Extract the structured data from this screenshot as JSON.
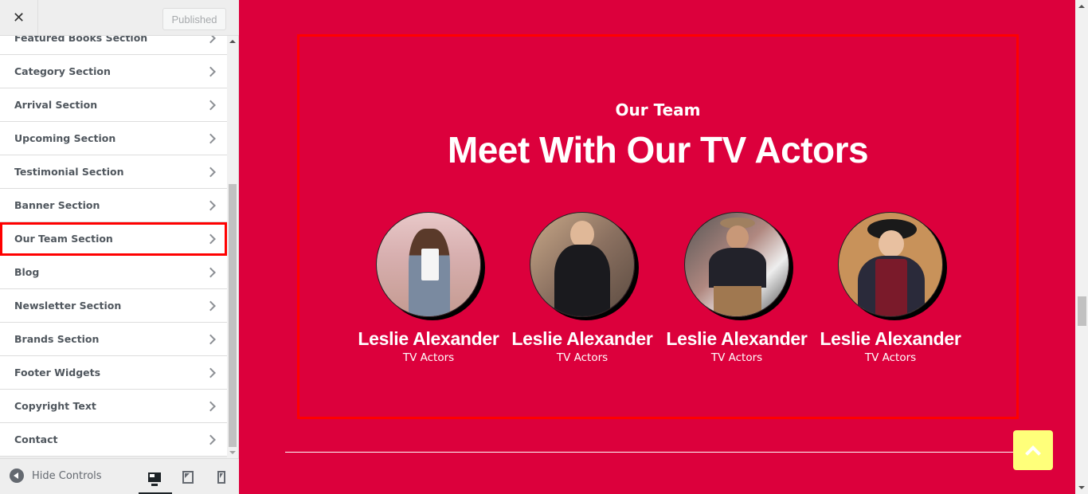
{
  "sidebar": {
    "close_label": "✕",
    "publish_label": "Published",
    "items": [
      {
        "label": "Featured Books Section"
      },
      {
        "label": "Category Section"
      },
      {
        "label": "Arrival Section"
      },
      {
        "label": "Upcoming Section"
      },
      {
        "label": "Testimonial Section"
      },
      {
        "label": "Banner Section"
      },
      {
        "label": "Our Team Section",
        "active": true
      },
      {
        "label": "Blog"
      },
      {
        "label": "Newsletter Section"
      },
      {
        "label": "Brands Section"
      },
      {
        "label": "Footer Widgets"
      },
      {
        "label": "Copyright Text"
      },
      {
        "label": "Contact"
      }
    ],
    "footer": {
      "hide_controls_label": "Hide Controls",
      "devices": [
        "desktop",
        "tablet",
        "mobile"
      ],
      "active_device": "desktop"
    }
  },
  "preview": {
    "background": "#dc003c",
    "team": {
      "subtitle": "Our Team",
      "title": "Meet With Our TV Actors",
      "members": [
        {
          "name": "Leslie Alexander",
          "role": "TV Actors"
        },
        {
          "name": "Leslie Alexander",
          "role": "TV Actors"
        },
        {
          "name": "Leslie Alexander",
          "role": "TV Actors"
        },
        {
          "name": "Leslie Alexander",
          "role": "TV Actors"
        }
      ]
    },
    "back_to_top_color": "#ffff7a"
  }
}
